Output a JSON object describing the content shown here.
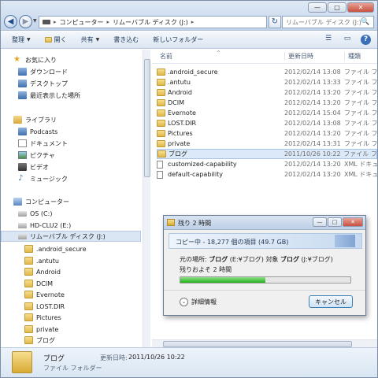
{
  "window": {
    "controls": {
      "minimize": "—",
      "maximize": "□",
      "close": "✕"
    }
  },
  "address": {
    "back": "◀",
    "forward": "▶",
    "dropdown": "▼",
    "segments": [
      "コンピューター",
      "リムーバブル ディスク (J:)"
    ],
    "separator": "▸",
    "refresh": "↻",
    "search_placeholder": "リムーバブル ディスク (J:)の検索",
    "search_icon": "🔍"
  },
  "toolbar": {
    "organize": "整理",
    "open": "開く",
    "share": "共有",
    "burn": "書き込む",
    "new_folder": "新しいフォルダー",
    "view_icon": "☰",
    "pane_icon": "▭",
    "help": "?"
  },
  "nav": {
    "favorites": "お気に入り",
    "downloads": "ダウンロード",
    "desktop": "デスクトップ",
    "recent": "最近表示した場所",
    "libraries": "ライブラリ",
    "podcasts": "Podcasts",
    "documents": "ドキュメント",
    "pictures_lib": "ピクチャ",
    "videos": "ビデオ",
    "music": "ミュージック",
    "computer": "コンピューター",
    "os": "OS (C:)",
    "hd": "HD-CLU2 (E:)",
    "removable": "リムーバブル ディスク (J:)",
    "subfolders": [
      ".android_secure",
      ".antutu",
      "Android",
      "DCIM",
      "Evernote",
      "LOST.DIR",
      "Pictures",
      "private",
      "ブログ"
    ]
  },
  "columns": {
    "name": "名前",
    "date": "更新日時",
    "type": "種類"
  },
  "files": [
    {
      "name": ".android_secure",
      "date": "2012/02/14 13:08",
      "type": "ファイル フォルダー",
      "kind": "folder"
    },
    {
      "name": ".antutu",
      "date": "2012/02/14 13:33",
      "type": "ファイル フォルダー",
      "kind": "folder"
    },
    {
      "name": "Android",
      "date": "2012/02/14 13:20",
      "type": "ファイル フォルダー",
      "kind": "folder"
    },
    {
      "name": "DCIM",
      "date": "2012/02/14 13:20",
      "type": "ファイル フォルダー",
      "kind": "folder"
    },
    {
      "name": "Evernote",
      "date": "2012/02/14 15:04",
      "type": "ファイル フォルダー",
      "kind": "folder"
    },
    {
      "name": "LOST.DIR",
      "date": "2012/02/14 13:08",
      "type": "ファイル フォルダー",
      "kind": "folder"
    },
    {
      "name": "Pictures",
      "date": "2012/02/14 13:20",
      "type": "ファイル フォルダー",
      "kind": "folder"
    },
    {
      "name": "private",
      "date": "2012/02/14 13:31",
      "type": "ファイル フォルダー",
      "kind": "folder"
    },
    {
      "name": "ブログ",
      "date": "2011/10/26 10:22",
      "type": "ファイル フォルダー",
      "kind": "folder"
    },
    {
      "name": "customized-capability",
      "date": "2012/02/14 13:20",
      "type": "XML ドキュメント",
      "kind": "xml"
    },
    {
      "name": "default-capability",
      "date": "2012/02/14 13:20",
      "type": "XML ドキュメント",
      "kind": "xml"
    }
  ],
  "details": {
    "name": "ブログ",
    "type": "ファイル フォルダー",
    "date_label": "更新日時:",
    "date": "2011/10/26 10:22"
  },
  "dialog": {
    "title": "残り 2 時間",
    "controls": {
      "minimize": "—",
      "maximize": "□",
      "close": "✕"
    },
    "banner": "コピー中 - 18,277 個の項目 (49.7 GB)",
    "from_label": "元の場所:",
    "from_value": "ブログ",
    "from_path": "(E:¥ブログ)",
    "to_label": "対象",
    "to_value": "ブログ",
    "to_path": "(J:¥ブログ)",
    "remaining": "残りおよそ 2 時間",
    "progress": 0.5,
    "more_icon": "⌄",
    "more": "詳細情報",
    "cancel": "キャンセル"
  }
}
